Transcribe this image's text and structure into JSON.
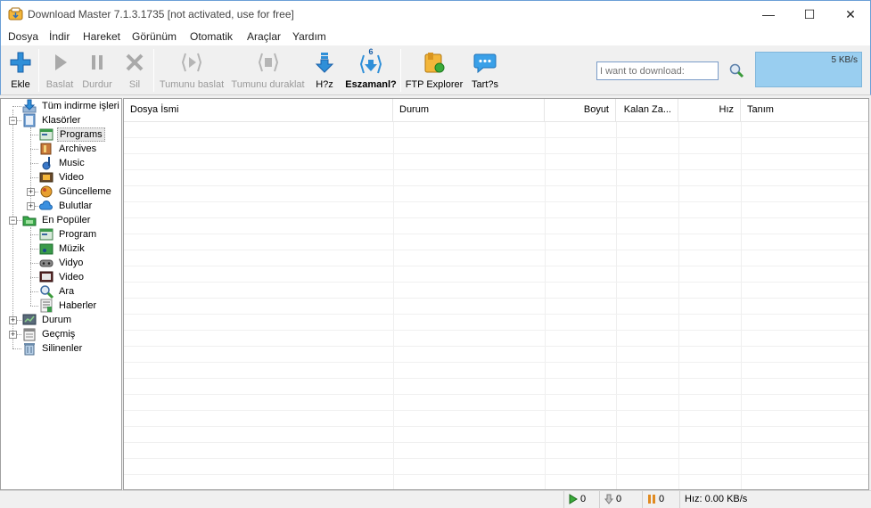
{
  "window": {
    "title": "Download Master 7.1.3.1735 [not activated, use for free]",
    "minimize_glyph": "—",
    "maximize_glyph": "☐",
    "close_glyph": "✕"
  },
  "menu": [
    "Dosya",
    "İndir",
    "Hareket",
    "Görünüm",
    "Otomatik",
    "Araçlar",
    "Yardım"
  ],
  "toolbar": {
    "add": "Ekle",
    "start": "Baslat",
    "stop": "Durdur",
    "delete": "Sil",
    "start_all": "Tumunu baslat",
    "stop_all": "Tumunu duraklat",
    "speed": "H?z",
    "simultaneous": "Eszamanl?",
    "simultaneous_count": "6",
    "ftp": "FTP Explorer",
    "discuss": "Tart?s",
    "url_placeholder": "I want to download:",
    "speed_display": "5 KB/s"
  },
  "tree": {
    "all_downloads": "Tüm indirme işleri",
    "folders": "Klasörler",
    "programs": "Programs",
    "archives": "Archives",
    "music": "Music",
    "video": "Video",
    "updates": "Güncelleme",
    "clouds": "Bulutlar",
    "popular": "En Popüler",
    "pop_program": "Program",
    "pop_music": "Müzik",
    "pop_vidyo": "Vidyo",
    "pop_video": "Video",
    "pop_search": "Ara",
    "pop_news": "Haberler",
    "status": "Durum",
    "history": "Geçmiş",
    "deleted": "Silinenler"
  },
  "columns": [
    "Dosya İsmi",
    "Durum",
    "Boyut",
    "Kalan Za...",
    "Hız",
    "Tanım"
  ],
  "statusbar": {
    "active": "0",
    "downloaded": "0",
    "paused": "0",
    "speed": "Hız: 0.00 KB/s"
  },
  "colors": {
    "accent_blue": "#2f8fd8",
    "speed_box": "#99cef0",
    "disabled_text": "#9a9a9a"
  }
}
